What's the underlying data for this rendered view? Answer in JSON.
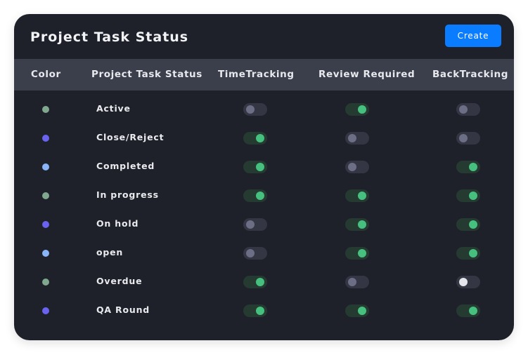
{
  "panel": {
    "title": "Project Task Status",
    "create_label": "Create"
  },
  "colors": {
    "accent": "#0a7cff",
    "toggle_on": "#46c07f",
    "toggle_off": "#6c6e85"
  },
  "table": {
    "headers": [
      "Color",
      "Project Task Status",
      "TimeTracking",
      "Review Required",
      "BackTracking"
    ],
    "rows": [
      {
        "color": "#7fa88f",
        "status": "Active",
        "time_tracking": false,
        "review_required": true,
        "back_tracking": false
      },
      {
        "color": "#6a63f0",
        "status": "Close/Reject",
        "time_tracking": true,
        "review_required": false,
        "back_tracking": false
      },
      {
        "color": "#8ab4f8",
        "status": "Completed",
        "time_tracking": true,
        "review_required": false,
        "back_tracking": true
      },
      {
        "color": "#7fa88f",
        "status": "In progress",
        "time_tracking": true,
        "review_required": true,
        "back_tracking": true
      },
      {
        "color": "#6a63f0",
        "status": "On hold",
        "time_tracking": false,
        "review_required": true,
        "back_tracking": true
      },
      {
        "color": "#8ab4f8",
        "status": "open",
        "time_tracking": false,
        "review_required": true,
        "back_tracking": true
      },
      {
        "color": "#7fa88f",
        "status": "Overdue",
        "time_tracking": true,
        "review_required": false,
        "back_tracking": false
      },
      {
        "color": "#6a63f0",
        "status": "QA Round",
        "time_tracking": true,
        "review_required": true,
        "back_tracking": true
      }
    ]
  }
}
